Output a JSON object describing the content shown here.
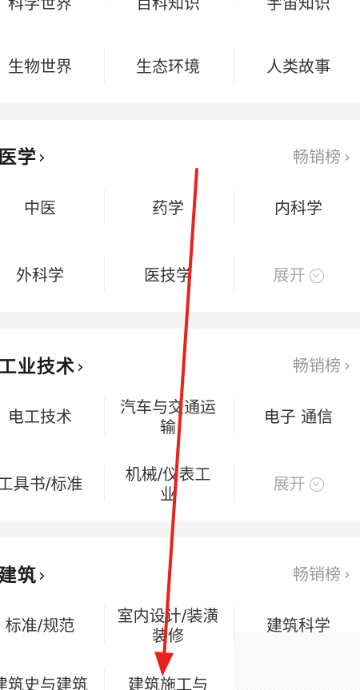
{
  "sections": {
    "science": {
      "row0": [
        "科学世界",
        "百科知识",
        "宇宙知识"
      ],
      "row1": [
        "生物世界",
        "生态环境",
        "人类故事"
      ]
    },
    "medicine": {
      "title": "医学",
      "rank_label": "畅销榜",
      "row0": [
        "中医",
        "药学",
        "内科学"
      ],
      "row1": [
        "外科学",
        "医技学",
        "展开"
      ]
    },
    "industry": {
      "title": "工业技术",
      "rank_label": "畅销榜",
      "row0": [
        "电工技术",
        "汽车与交通运输",
        "电子 通信"
      ],
      "row1": [
        "工具书/标准",
        "机械/仪表工业",
        "展开"
      ]
    },
    "architecture": {
      "title": "建筑",
      "rank_label": "畅销榜",
      "row0": [
        "标准/规范",
        "室内设计/装潢装修",
        "建筑科学"
      ],
      "row1": [
        "建筑史与建筑",
        "建筑施工与"
      ]
    }
  },
  "icons": {
    "chevron": "chevron-right-icon",
    "expand": "expand-circle-icon"
  },
  "colors": {
    "background": "#f4f4f4",
    "card": "#ffffff",
    "muted": "#9a9a9a",
    "annotation_arrow": "#e8231b"
  }
}
